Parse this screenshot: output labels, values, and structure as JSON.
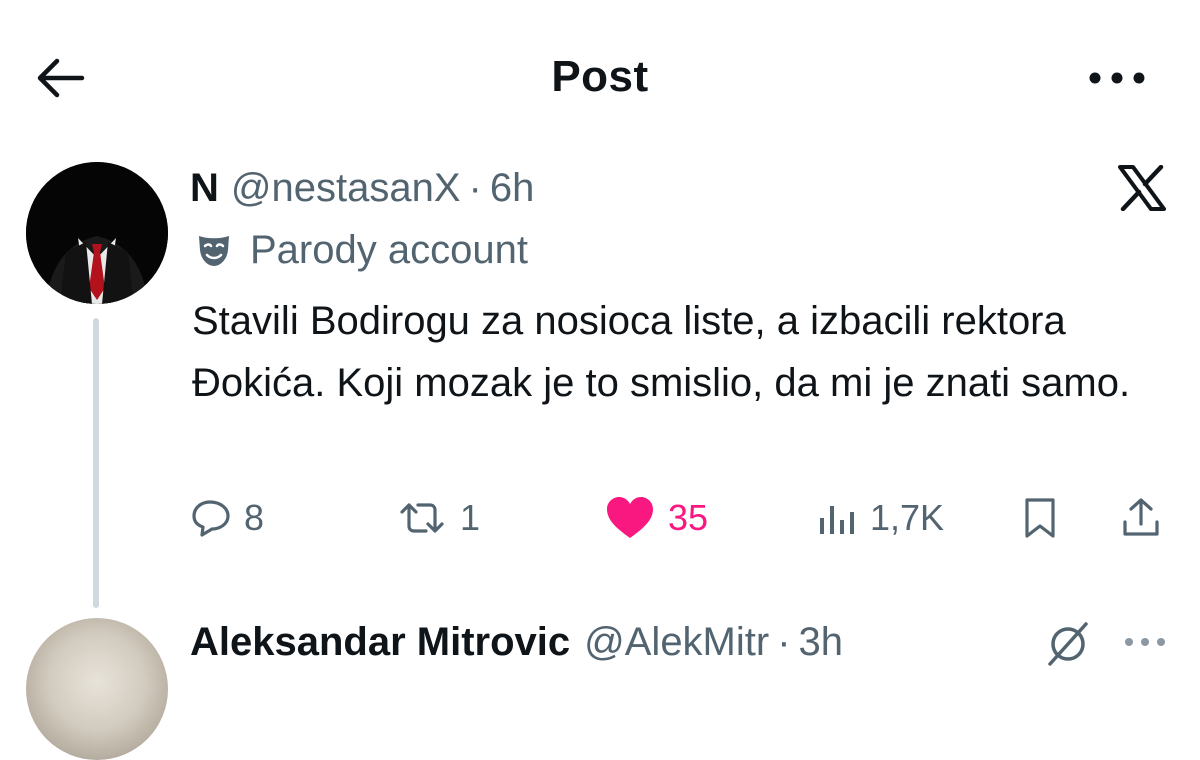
{
  "header": {
    "title": "Post",
    "back_icon": "arrow-left-icon",
    "more_icon": "more-horizontal-icon"
  },
  "post": {
    "display_name": "N",
    "handle": "@nestasanX",
    "separator": "·",
    "time": "6h",
    "platform_logo": "x-logo-icon",
    "label_icon": "theater-mask-icon",
    "label": "Parody account",
    "text": "Stavili Bodirogu za nosioca liste, a izbacili rektora Đokića. Koji mozak je to smislio, da mi je znati samo.",
    "actions": {
      "replies": "8",
      "reposts": "1",
      "likes": "35",
      "views": "1,7K"
    }
  },
  "reply": {
    "display_name": "Aleksandar Mitrovic",
    "handle": "@AlekMitr",
    "separator": "·",
    "time": "3h",
    "icon": "grok-icon"
  },
  "colors": {
    "text": "#0f1419",
    "secondary": "#536471",
    "like": "#f91880",
    "thread_line": "#cfd9de"
  }
}
